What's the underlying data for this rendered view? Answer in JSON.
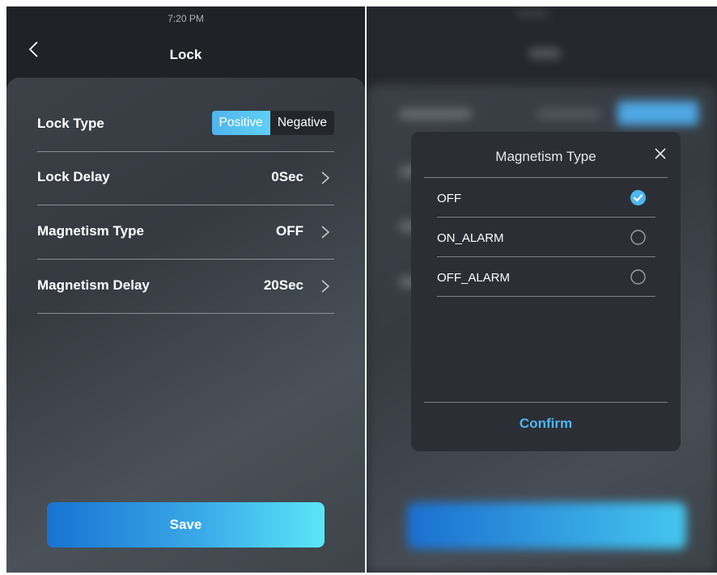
{
  "left_screen": {
    "status_time": "7:20 PM",
    "title": "Lock",
    "lock_type": {
      "label": "Lock Type",
      "options": [
        "Positive",
        "Negative"
      ],
      "selected": "Positive"
    },
    "rows": [
      {
        "label": "Lock Delay",
        "value": "0Sec"
      },
      {
        "label": "Magnetism Type",
        "value": "OFF"
      },
      {
        "label": "Magnetism Delay",
        "value": "20Sec"
      }
    ],
    "save_label": "Save",
    "accent_color": "#4fb6ef"
  },
  "right_screen": {
    "dialog": {
      "title": "Magnetism Type",
      "options": [
        {
          "label": "OFF",
          "selected": true
        },
        {
          "label": "ON_ALARM",
          "selected": false
        },
        {
          "label": "OFF_ALARM",
          "selected": false
        }
      ],
      "confirm_label": "Confirm"
    }
  }
}
